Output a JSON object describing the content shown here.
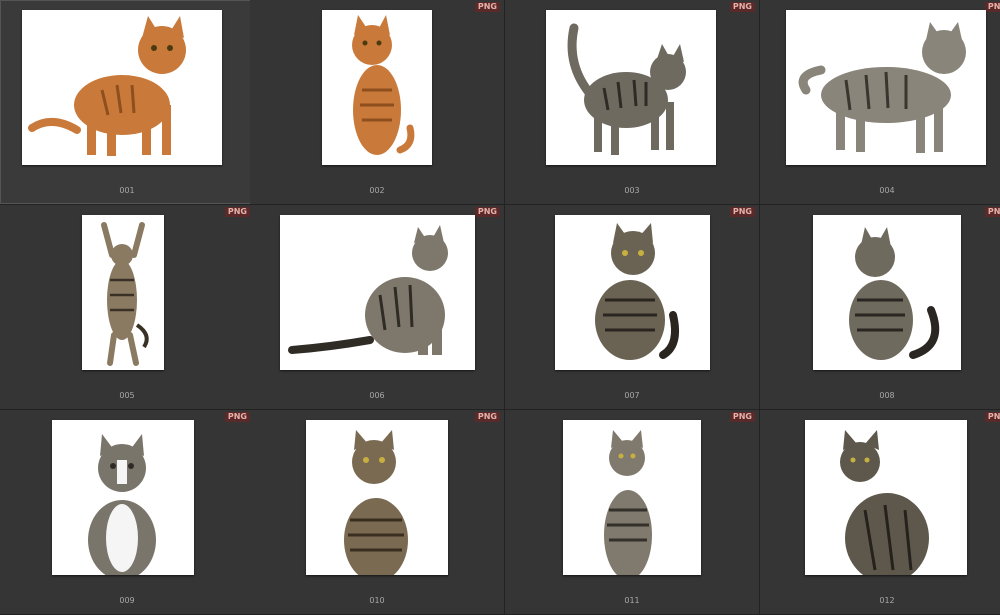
{
  "grid": {
    "badge": "PNG",
    "items": [
      {
        "label": "001",
        "cat": "orange cat standing",
        "color": "#c97a3a",
        "stripe": "#8e4f1e"
      },
      {
        "label": "002",
        "cat": "orange cat sitting",
        "color": "#c97a3a",
        "stripe": "#8e4f1e"
      },
      {
        "label": "003",
        "cat": "tabby cat arched",
        "color": "#6e6a60",
        "stripe": "#2e2b26"
      },
      {
        "label": "004",
        "cat": "tabby cat standing",
        "color": "#8a857a",
        "stripe": "#3a362f"
      },
      {
        "label": "005",
        "cat": "tabby cat stretching",
        "color": "#8a7a62",
        "stripe": "#3a3126"
      },
      {
        "label": "006",
        "cat": "tabby cat sitting side",
        "color": "#7e786c",
        "stripe": "#2f2b25"
      },
      {
        "label": "007",
        "cat": "tabby cat sitting front",
        "color": "#6a6354",
        "stripe": "#2a261f"
      },
      {
        "label": "008",
        "cat": "tabby cat sitting looking left",
        "color": "#6f6a5e",
        "stripe": "#2a2722"
      },
      {
        "label": "009",
        "cat": "tabby white kitten",
        "color": "#7a756a",
        "stripe": "#2e2b26"
      },
      {
        "label": "010",
        "cat": "tabby kitten sitting",
        "color": "#7a6a52",
        "stripe": "#3a2e20"
      },
      {
        "label": "011",
        "cat": "tabby cat sitting tall",
        "color": "#807a6e",
        "stripe": "#34302a"
      },
      {
        "label": "012",
        "cat": "tabby cat sitting back",
        "color": "#5e584c",
        "stripe": "#25221d"
      }
    ]
  }
}
